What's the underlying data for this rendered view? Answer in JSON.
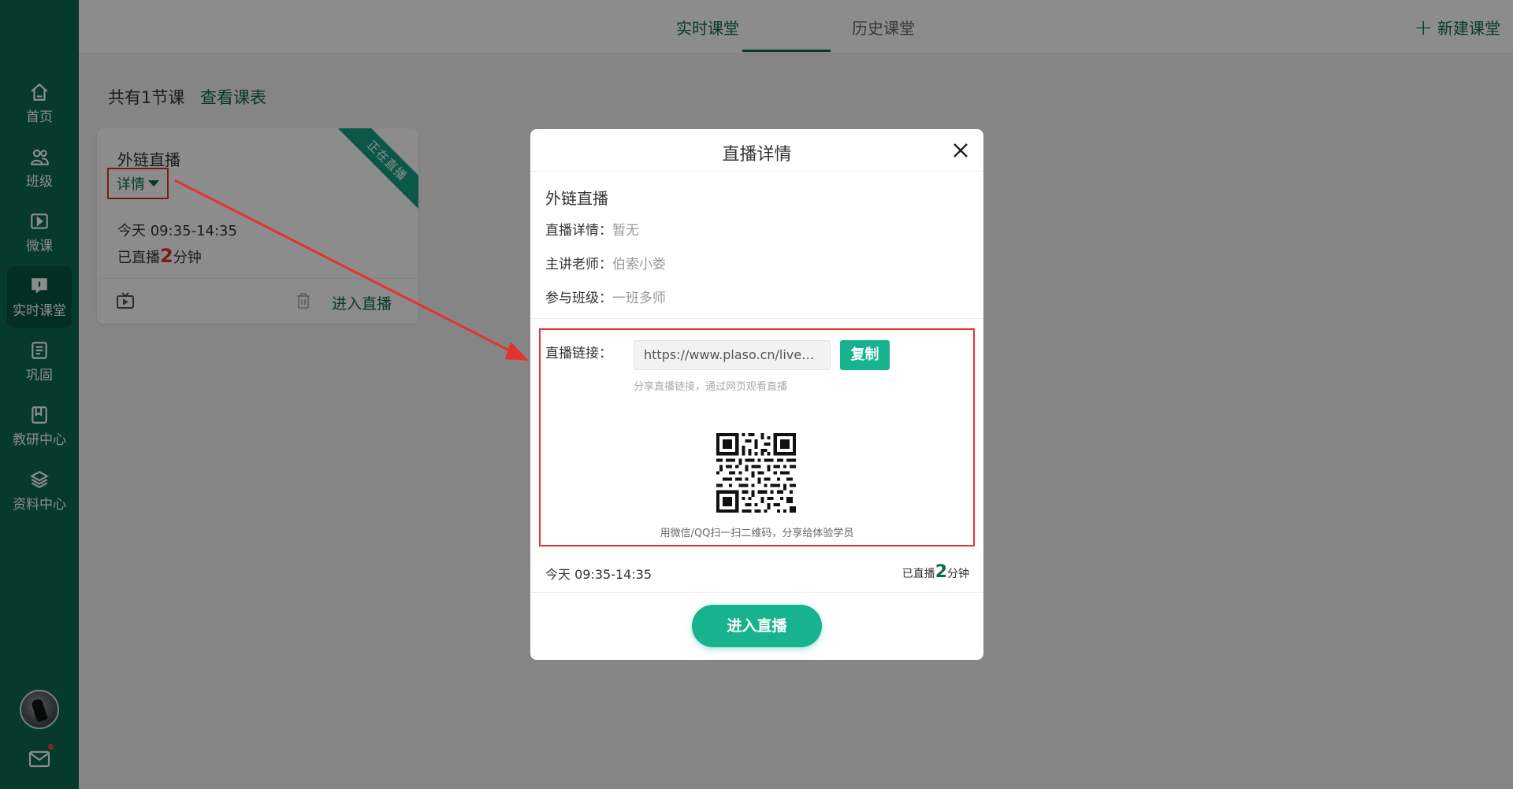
{
  "sidebar": {
    "items": [
      {
        "label": "首页",
        "icon": "home-icon"
      },
      {
        "label": "班级",
        "icon": "users-icon"
      },
      {
        "label": "微课",
        "icon": "play-box-icon"
      },
      {
        "label": "实时课堂",
        "icon": "live-chat-icon",
        "active": true
      },
      {
        "label": "巩固",
        "icon": "list-icon"
      },
      {
        "label": "教研中心",
        "icon": "book-icon"
      },
      {
        "label": "资料中心",
        "icon": "layers-icon"
      }
    ]
  },
  "header": {
    "tabs": [
      {
        "label": "实时课堂",
        "active": true
      },
      {
        "label": "历史课堂",
        "active": false
      }
    ],
    "new_class_label": "新建课堂"
  },
  "content": {
    "count_text": "共有1节课",
    "view_schedule_label": "查看课表"
  },
  "card": {
    "title": "外链直播",
    "details_label": "详情",
    "ribbon_label": "正在直播",
    "time": "今天 09:35-14:35",
    "duration_prefix": "已直播",
    "duration_value": "2",
    "duration_suffix": "分钟",
    "enter_label": "进入直播"
  },
  "modal": {
    "title": "直播详情",
    "name": "外链直播",
    "detail_label": "直播详情：",
    "detail_value": "暂无",
    "teacher_label": "主讲老师：",
    "teacher_value": "伯索小娄",
    "class_label": "参与班级：",
    "class_value": "一班多师",
    "link_label": "直播链接：",
    "link_value": "https://www.plaso.cn/livevid...",
    "copy_label": "复制",
    "share_hint": "分享直播链接，通过网页观看直播",
    "qr_caption": "用微信/QQ扫一扫二维码，分享给体验学员",
    "time": "今天 09:35-14:35",
    "duration_prefix": "已直播",
    "duration_value": "2",
    "duration_suffix": "分钟",
    "enter_label": "进入直播"
  },
  "colors": {
    "brand": "#0c6a51",
    "accent": "#17b38f",
    "highlight": "#e5322d"
  }
}
